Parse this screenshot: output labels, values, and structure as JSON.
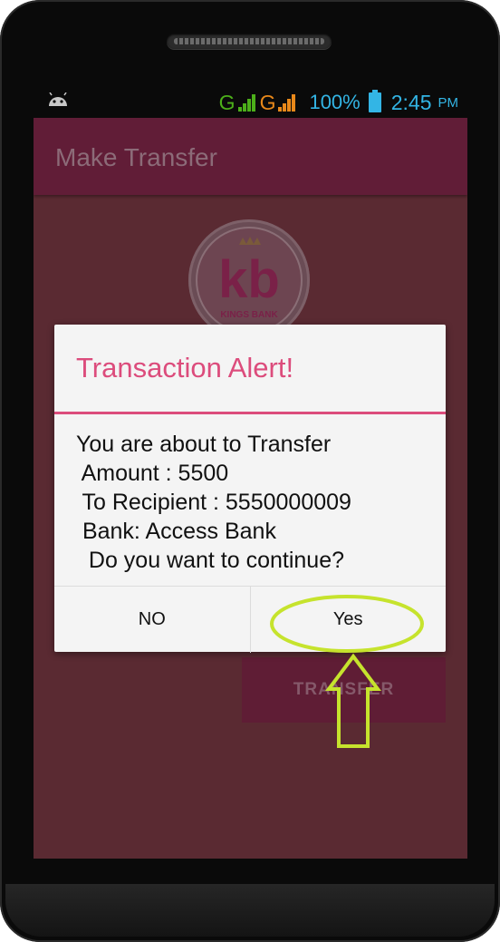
{
  "status_bar": {
    "network_1": "G",
    "network_2": "G",
    "battery_percent": "100%",
    "time": "2:45",
    "ampm": "PM",
    "colors": {
      "network_1": "#4caf1a",
      "network_2": "#e8881a",
      "info": "#33b5e5"
    },
    "icons": [
      "android-debug-icon",
      "signal-icon",
      "battery-icon"
    ]
  },
  "app_bar": {
    "title": "Make Transfer"
  },
  "logo": {
    "monogram": "kb",
    "name": "KINGS BANK"
  },
  "form": {
    "transfer_label": "TRANSFER"
  },
  "dialog": {
    "title": "Transaction Alert!",
    "message_lines": [
      "You are about to Transfer",
      " Amount : 5500",
      " To Recipient : 5550000009",
      " Bank: Access Bank",
      "  Do you want to continue?"
    ],
    "negative_label": "NO",
    "positive_label": "Yes"
  },
  "annotation": {
    "color": "#c6e32d",
    "highlight": "positive-button",
    "icon": "up-arrow-icon"
  },
  "colors": {
    "accent": "#dc4c7c",
    "app_bar": "#611d37",
    "background_dimmed": "#5a2a32"
  }
}
